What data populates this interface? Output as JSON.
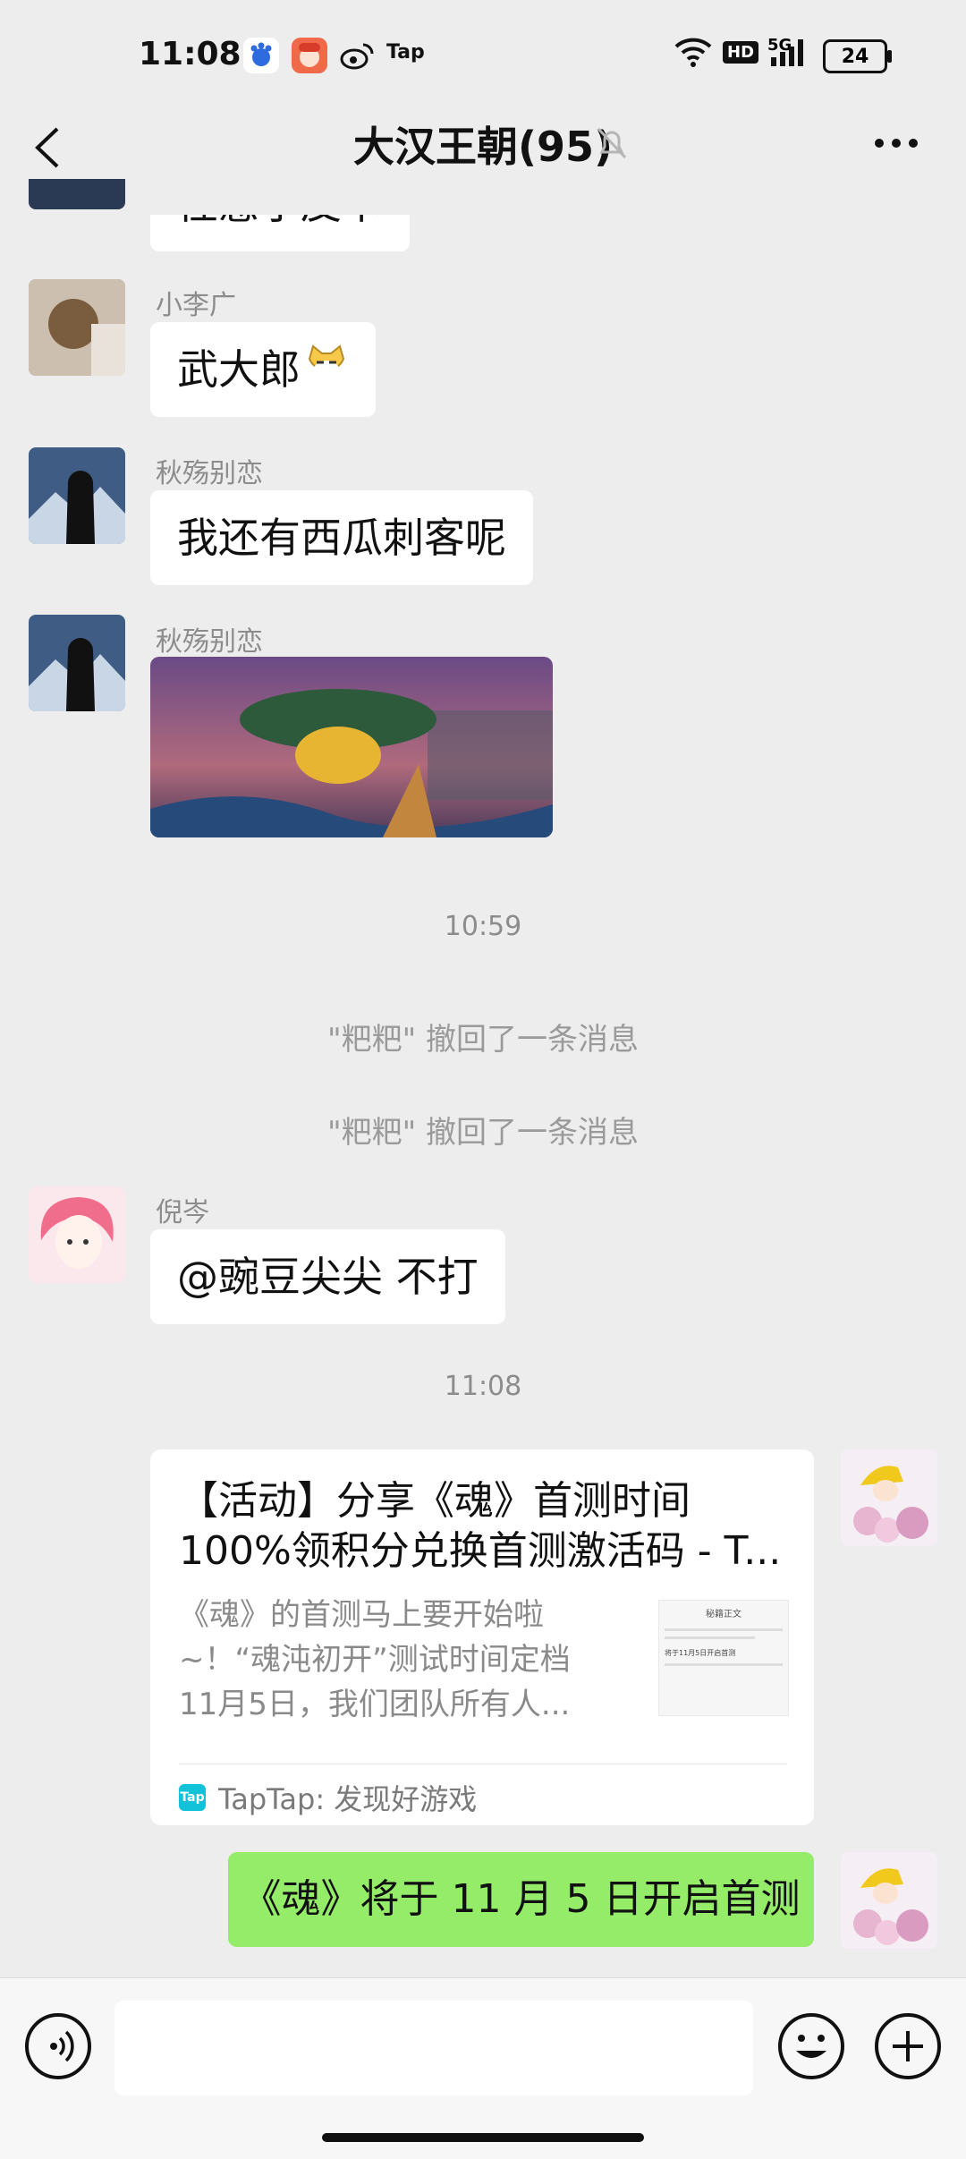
{
  "status_bar": {
    "time": "11:08",
    "app_icons": [
      "baidu-icon",
      "avatar-app-icon",
      "weibo-icon",
      "tap-icon"
    ],
    "tap_text": "Tap",
    "network": "5G",
    "hd": "HD",
    "battery": "24"
  },
  "header": {
    "title": "大汉王朝(95)",
    "icons": [
      "back-icon",
      "mute-bell-icon",
      "more-icon"
    ]
  },
  "messages": {
    "partial_text": "性感小皮卡",
    "m1": {
      "name": "小李广",
      "text": "武大郎"
    },
    "m2": {
      "name": "秋殇别恋",
      "text": "我还有西瓜刺客呢"
    },
    "m3": {
      "name": "秋殇别恋"
    },
    "time1": "10:59",
    "recall1": "\"粑粑\" 撤回了一条消息",
    "recall2": "\"粑粑\" 撤回了一条消息",
    "m4": {
      "name": "倪岑",
      "text": "@豌豆尖尖  不打"
    },
    "time2": "11:08",
    "card": {
      "title_line1": "【活动】分享《魂》首测时间",
      "title_line2": "100%领积分兑换首测激活码 - T...",
      "desc_line1": "《魂》的首测马上要开始啦",
      "desc_line2": "~！“魂沌初开”测试时间定档",
      "desc_line3": "11月5日，我们团队所有人...",
      "source": "TapTap: 发现好游戏",
      "logo_text": "Tap",
      "thumb_title": "秘籍正文",
      "thumb_text": "将于11月5日开启首测"
    },
    "own_text": "《魂》将于 11 月 5 日开启首测"
  },
  "input_bar": {
    "icons": [
      "voice-icon",
      "emoji-icon",
      "plus-icon"
    ],
    "placeholder": ""
  },
  "colors": {
    "bg": "#ededed",
    "own_bubble": "#95ec69",
    "tap_brand": "#12c2d8"
  }
}
